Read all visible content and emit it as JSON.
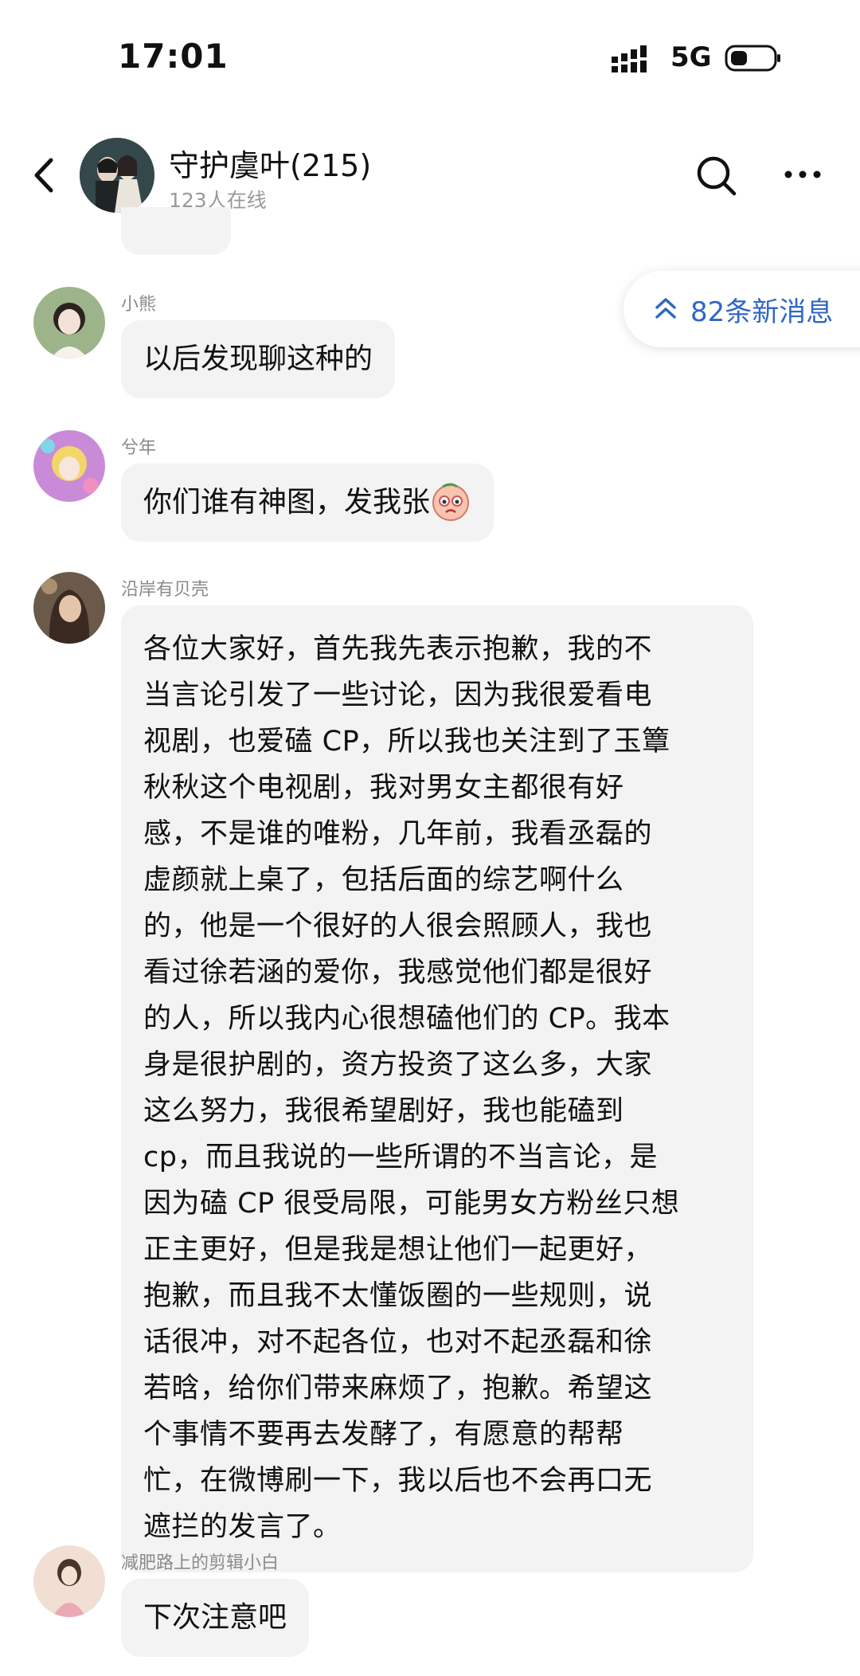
{
  "status_bar": {
    "time": "17:01",
    "network": "5G",
    "icons": [
      "signal-icon",
      "battery-icon"
    ]
  },
  "header": {
    "title": "守护虞叶(215)",
    "online": "123人在线",
    "icons": [
      "back-icon",
      "search-icon",
      "more-icon"
    ]
  },
  "new_messages": {
    "label": "82条新消息",
    "icon": "double-chevron-up-icon",
    "color": "#2f67c4"
  },
  "messages": [
    {
      "sender": "小熊",
      "text": "以后发现聊这种的"
    },
    {
      "sender": "兮年",
      "text": "你们谁有神图，发我张",
      "emoji": "crying-face-emoji"
    },
    {
      "sender": "沿岸有贝壳",
      "lines": [
        "各位大家好，首先我先表示抱歉，我的不",
        "当言论引发了一些讨论，因为我很爱看电",
        "视剧，也爱磕 CP，所以我也关注到了玉簟",
        "秋秋这个电视剧，我对男女主都很有好",
        "感，不是谁的唯粉，几年前，我看丞磊的",
        "虚颜就上桌了，包括后面的综艺啊什么",
        "的，他是一个很好的人很会照顾人，我也",
        "看过徐若涵的爱你，我感觉他们都是很好",
        "的人，所以我内心很想磕他们的 CP。我本",
        "身是很护剧的，资方投资了这么多，大家",
        "这么努力，我很希望剧好，我也能磕到",
        "cp，而且我说的一些所谓的不当言论，是",
        "因为磕 CP 很受局限，可能男女方粉丝只想",
        "正主更好，但是我是想让他们一起更好，",
        "抱歉，而且我不太懂饭圈的一些规则，说",
        "话很冲，对不起各位，也对不起丞磊和徐",
        "若晗，给你们带来麻烦了，抱歉。希望这",
        "个事情不要再去发酵了，有愿意的帮帮",
        "忙，在微博刷一下，我以后也不会再口无",
        "遮拦的发言了。"
      ]
    },
    {
      "sender": "减肥路上的剪辑小白",
      "text": "下次注意吧"
    }
  ],
  "colors": {
    "bubble": "#f3f3f4",
    "sender_name": "#8a8a8a",
    "subtitle": "#999999"
  }
}
